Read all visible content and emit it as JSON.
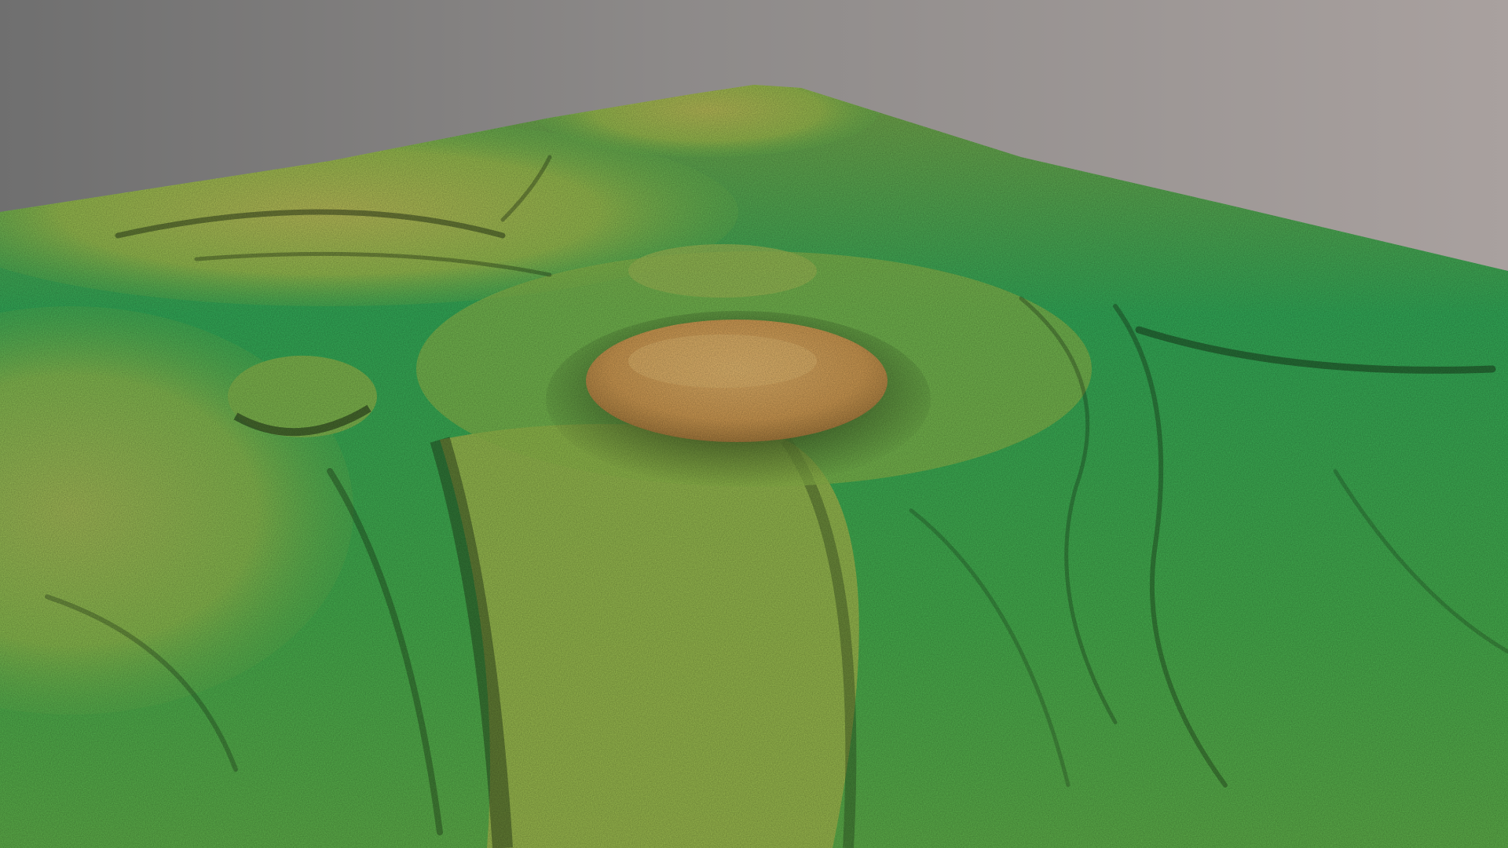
{
  "scene": {
    "subject": "terrain-relief-model",
    "colors": {
      "sky_dark": "#6f6f6f",
      "sky_light": "#a9a19f",
      "lowland_green": "#2fae55",
      "midland_green": "#58b64a",
      "upland_yellow": "#b7bf4f",
      "summit_tan": "#d8a85a",
      "shadow": "#1b2a12"
    }
  }
}
